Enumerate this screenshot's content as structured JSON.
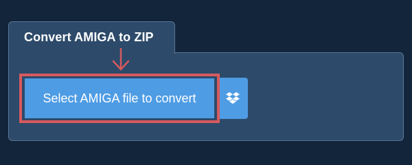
{
  "converter": {
    "tab_title": "Convert AMIGA to ZIP",
    "select_button_label": "Select AMIGA file to convert",
    "dropbox_icon": "dropbox-icon",
    "pointer_icon": "arrow-down-icon"
  },
  "colors": {
    "background": "#13253a",
    "panel": "#2d4a6a",
    "panel_border": "#5a7696",
    "button": "#4e9ce4",
    "highlight": "#d75a5e",
    "text": "#ffffff"
  }
}
